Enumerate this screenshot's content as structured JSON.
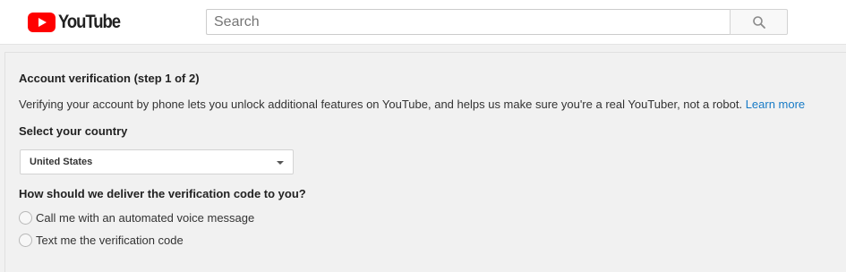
{
  "header": {
    "logo_text": "YouTube",
    "search": {
      "placeholder": "Search",
      "value": ""
    },
    "search_button_icon": "search-icon"
  },
  "verification": {
    "title": "Account verification (step 1 of 2)",
    "intro_text": "Verifying your account by phone lets you unlock additional features on YouTube, and helps us make sure you're a real YouTuber, not a robot.",
    "learn_more": "Learn more",
    "country_heading": "Select your country",
    "country_selected": "United States",
    "deliver_heading": "How should we deliver the verification code to you?",
    "options": [
      {
        "label": "Call me with an automated voice message",
        "selected": false
      },
      {
        "label": "Text me the verification code",
        "selected": false
      }
    ]
  },
  "colors": {
    "brand_red": "#ff0000",
    "link": "#167ac6",
    "page_background": "#f1f1f1"
  }
}
